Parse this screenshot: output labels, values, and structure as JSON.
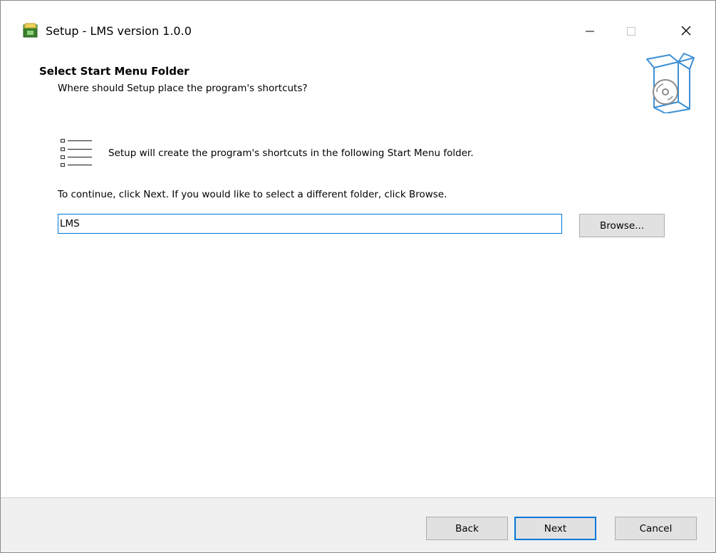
{
  "window": {
    "title": "Setup - LMS version 1.0.0",
    "icons": {
      "app": "installer-app-icon",
      "minimize": "minimize-icon",
      "maximize": "maximize-icon",
      "close": "close-icon"
    }
  },
  "header": {
    "title": "Select Start Menu Folder",
    "subtitle": "Where should Setup place the program's shortcuts?",
    "graphic": "software-box-icon"
  },
  "body": {
    "list_icon": "shortcut-list-icon",
    "info_text": "Setup will create the program's shortcuts in the following Start Menu folder.",
    "instructions": "To continue, click Next. If you would like to select a different folder, click Browse.",
    "folder_value": "LMS",
    "browse_label": "Browse..."
  },
  "footer": {
    "back_label": "Back",
    "next_label": "Next",
    "cancel_label": "Cancel"
  },
  "colors": {
    "accent": "#0078d7",
    "button_face": "#e1e1e1",
    "button_border": "#adadad",
    "footer_bg": "#f0f0f0"
  }
}
